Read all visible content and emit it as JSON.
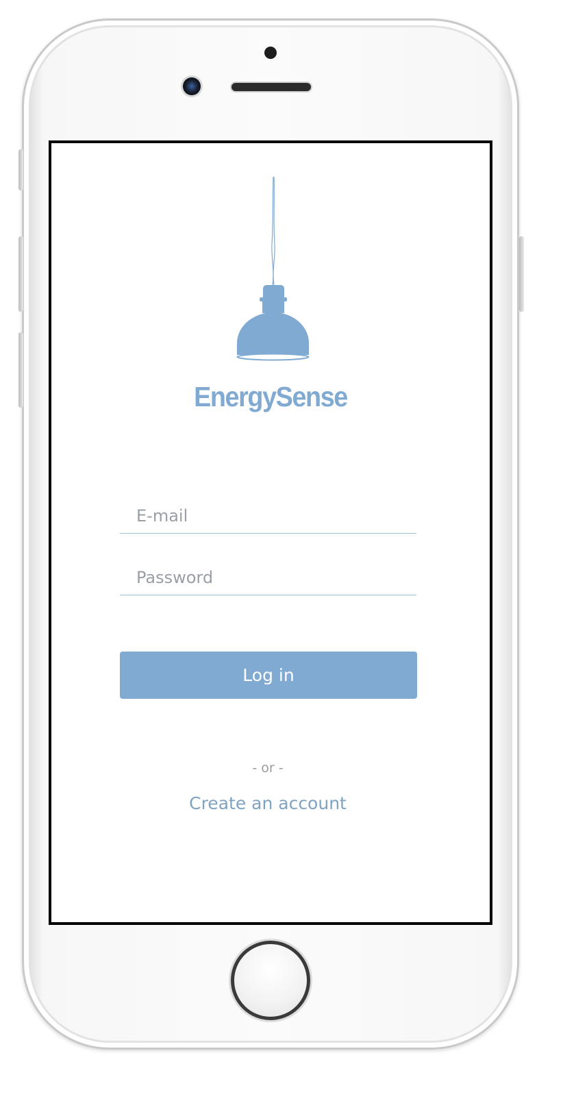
{
  "app": {
    "brand_name": "EnergySense",
    "logo_icon": "pendant-lamp-icon"
  },
  "login_form": {
    "email_placeholder": "E-mail",
    "email_value": "",
    "password_placeholder": "Password",
    "password_value": "",
    "login_label": "Log in",
    "separator_text": "- or -",
    "create_account_label": "Create an account"
  },
  "colors": {
    "accent": "#80aad2",
    "link": "#7fa3c0",
    "field_underline": "#9cc3d8",
    "placeholder": "#9a9ea6"
  }
}
